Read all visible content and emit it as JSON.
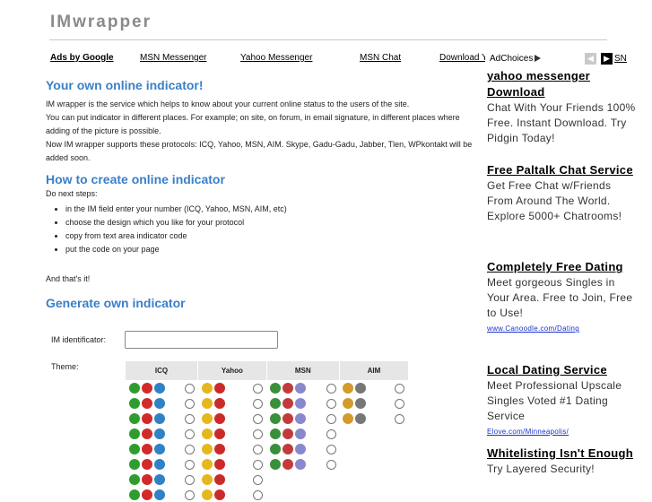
{
  "site": {
    "logo": "IMwrapper"
  },
  "linkbar": {
    "title": "Ads by Google",
    "links": [
      "MSN Messenger",
      "Yahoo Messenger",
      "MSN Chat",
      "Download Y"
    ]
  },
  "adchoices": {
    "label": "AdChoices",
    "next_cut": "SN"
  },
  "main": {
    "h1": "Your own online indicator!",
    "intro": [
      "IM wrapper is the service which helps to know about your current online status to the users of the site.",
      "You can put indicator in different places. For example; on site, on forum, in email signature, in different places where adding of the picture is possible.",
      "Now IM wrapper supports these protocols: ICQ, Yahoo, MSN, AIM. Skype, Gadu-Gadu, Jabber, Tlen, WPkontakt will be added soon."
    ],
    "h2": "How to create online indicator",
    "steps_lead": "Do next steps:",
    "steps": [
      "in the IM field enter your number (ICQ, Yahoo, MSN, AIM, etc)",
      "choose the design which you like for your protocol",
      "copy from text area indicator code",
      "put the code on your page"
    ],
    "outro": "And that's it!",
    "h3": "Generate own indicator",
    "im_label": "IM identificator:",
    "im_value": "",
    "theme_label": "Theme:",
    "table_headers": [
      "ICQ",
      "Yahoo",
      "MSN",
      "AIM"
    ]
  },
  "colors": {
    "heading": "#3a7fc8",
    "icq": [
      "#2e9d2e",
      "#d12a2a",
      "#2f82c4"
    ],
    "yahoo": [
      "#e3b81e",
      "#cc2a2a",
      "#777777"
    ],
    "msn": [
      "#3a8f3a",
      "#c23b3b",
      "#8888cc"
    ],
    "aim": [
      "#d39a2c",
      "#777777"
    ]
  },
  "ads": [
    {
      "title": "yahoo messenger Download",
      "body": "Chat With Your Friends 100% Free. Instant Download. Try Pidgin Today!",
      "url": ""
    },
    {
      "title": "Free Paltalk Chat Service",
      "body": "Get Free Chat w/Friends From Around The World. Explore 5000+ Chatrooms!",
      "url": ""
    },
    {
      "title": "Completely Free Dating",
      "body": "Meet gorgeous Singles in Your Area. Free to Join, Free to Use!",
      "url": "www.Canoodle.com/Dating"
    },
    {
      "title": "Local Dating Service",
      "body": "Meet Professional Upscale Singles Voted #1 Dating Service",
      "url": "Elove.com/Minneapolis/"
    },
    {
      "title": "Whitelisting Isn't Enough",
      "body": "Try Layered Security!",
      "url": ""
    }
  ]
}
